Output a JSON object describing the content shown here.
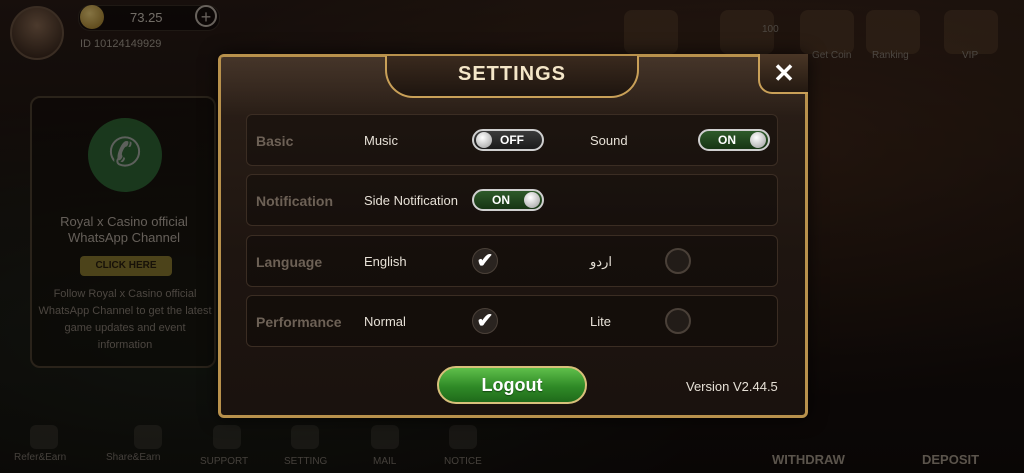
{
  "background": {
    "balance": "73.25",
    "player_id": "ID  10124149929",
    "top_items": [
      "100",
      "Get Coin",
      "Ranking",
      "VIP"
    ],
    "promo": {
      "title": "Royal x Casino official WhatsApp Channel",
      "button": "CLICK HERE",
      "body": "Follow Royal x Casino official WhatsApp Channel to get the latest game updates and event information"
    },
    "bottom_nav": [
      "Refer&Earn",
      "Share&Earn",
      "SUPPORT",
      "SETTING",
      "MAIL",
      "NOTICE"
    ],
    "withdraw_label": "WITHDRAW",
    "deposit_label": "DEPOSIT"
  },
  "settings": {
    "title": "SETTINGS",
    "close_label": "✕",
    "rows": [
      {
        "category": "Basic",
        "opt1": "Music",
        "opt1_state": "OFF",
        "opt2": "Sound",
        "opt2_state": "ON"
      },
      {
        "category": "Notification",
        "opt1": "Side Notification",
        "opt1_state": "ON"
      },
      {
        "category": "Language",
        "opt1": "English",
        "opt1_checked": true,
        "opt2": "اردو",
        "opt2_checked": false
      },
      {
        "category": "Performance",
        "opt1": "Normal",
        "opt1_checked": true,
        "opt2": "Lite",
        "opt2_checked": false
      }
    ],
    "check_glyph": "✔",
    "logout_label": "Logout",
    "version": "Version  V2.44.5"
  },
  "colors": {
    "frame_gold": "#b8914c",
    "toggle_on": "#2e5a2a",
    "logout_green": "#2f8a27"
  }
}
